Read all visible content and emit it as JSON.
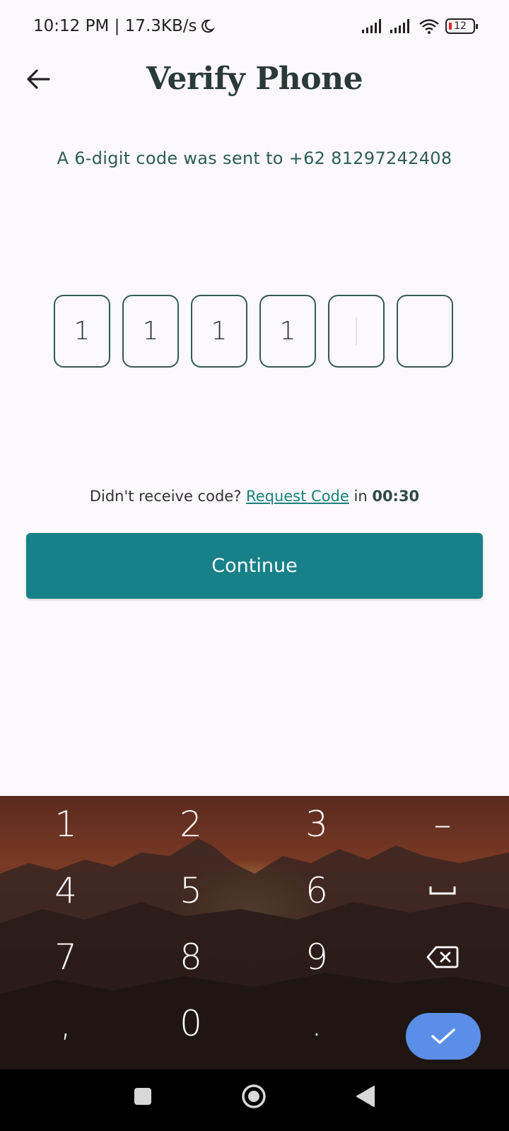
{
  "status": {
    "time_speed": "10:12 PM | 17.3KB/s",
    "battery": "12"
  },
  "header": {
    "title": "Verify Phone"
  },
  "subtitle": "A 6-digit code was sent to +62 81297242408",
  "otp": {
    "digits": [
      "1",
      "1",
      "1",
      "1",
      "",
      ""
    ]
  },
  "resend": {
    "prefix": "Didn't receive code?",
    "link": "Request Code",
    "middle": "in",
    "timer": "00:30"
  },
  "continue_label": "Continue",
  "keyboard": {
    "keys": [
      "1",
      "2",
      "3",
      "–",
      "4",
      "5",
      "6",
      "7",
      "8",
      "9",
      ",",
      "0",
      "."
    ]
  },
  "icons": {
    "back": "arrow-left-icon",
    "backspace": "backspace-icon",
    "enter": "check-icon",
    "space": "space-icon",
    "nav_home": "circle-icon",
    "nav_recents": "square-icon",
    "nav_back": "triangle-back-icon"
  },
  "colors": {
    "accent": "#178088",
    "link": "#17807a",
    "enter_key": "#5b8ee6",
    "background": "#fcf8fb"
  }
}
